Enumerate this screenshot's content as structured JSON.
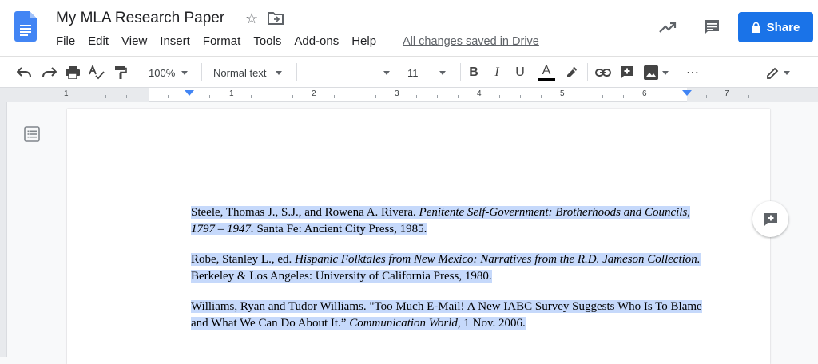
{
  "app": {
    "title": "My MLA Research Paper",
    "save_status": "All changes saved in Drive",
    "share_label": "Share"
  },
  "menu": [
    "File",
    "Edit",
    "View",
    "Insert",
    "Format",
    "Tools",
    "Add-ons",
    "Help"
  ],
  "toolbar": {
    "zoom": "100%",
    "style": "Normal text",
    "font_family": "",
    "font_size": "11",
    "bold": "B",
    "italic": "I",
    "underline": "U",
    "text_color": "A",
    "more": "⋯"
  },
  "ruler": {
    "numbers": [
      "1",
      "1",
      "2",
      "3",
      "4",
      "5",
      "6",
      "7"
    ]
  },
  "document": {
    "entries": [
      {
        "plain1": "Steele, Thomas J., S.J., and Rowena A. Rivera. ",
        "italic": "Penitente Self-Government: Brotherhoods and Councils, 1797 – 1947.",
        "plain2": " Santa Fe: Ancient City Press, 1985."
      },
      {
        "plain1": "Robe, Stanley L., ed. ",
        "italic": "Hispanic Folktales from New Mexico: Narratives from the R.D. Jameson Collection.",
        "plain2": " Berkeley & Los Angeles: University of California Press, 1980."
      },
      {
        "plain1": "Williams, Ryan and Tudor Williams. \"Too Much E-Mail! A New IABC Survey Suggests Who Is To Blame and What We Can Do About It.” ",
        "italic": "Communication World",
        "plain2": ", 1 Nov. 2006."
      }
    ]
  },
  "colors": {
    "share_blue": "#1a73e8",
    "selection": "#c6d9fb",
    "docs_blue": "#4285f4"
  },
  "icons": [
    "docs-logo-icon",
    "star-icon",
    "move-to-folder-icon",
    "activity-trend-icon",
    "comments-icon",
    "lock-icon",
    "undo-icon",
    "redo-icon",
    "print-icon",
    "spellcheck-icon",
    "paint-format-icon",
    "highlighter-icon",
    "link-icon",
    "add-comment-icon",
    "image-icon",
    "editing-mode-pencil-icon",
    "outline-icon"
  ]
}
